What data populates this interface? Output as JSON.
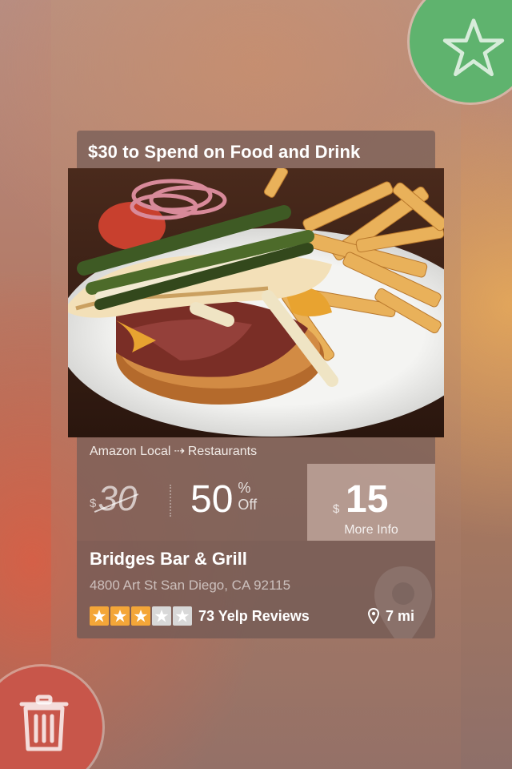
{
  "card": {
    "title": "$30 to Spend on Food and Drink",
    "category": {
      "source": "Amazon Local",
      "separator": "⇢",
      "section": "Restaurants"
    },
    "deal": {
      "original_currency": "$",
      "original_value": "30",
      "discount_value": "50",
      "discount_percent_sign": "%",
      "discount_off_label": "Off",
      "price_currency": "$",
      "price_value": "15",
      "more_info_label": "More Info"
    },
    "business": {
      "name": "Bridges Bar & Grill",
      "address": "4800 Art St San Diego, CA 92115",
      "rating": 3,
      "rating_max": 5,
      "reviews_label": "73 Yelp Reviews",
      "distance_label": "7 mi"
    }
  },
  "colors": {
    "star_button": "#5fb36e",
    "trash_button": "#c8564a",
    "rating_star_filled": "#f4a638",
    "rating_star_empty": "#d8d8d8"
  },
  "icons": {
    "favorite": "star-icon",
    "discard": "trash-icon",
    "location": "map-pin-icon"
  }
}
